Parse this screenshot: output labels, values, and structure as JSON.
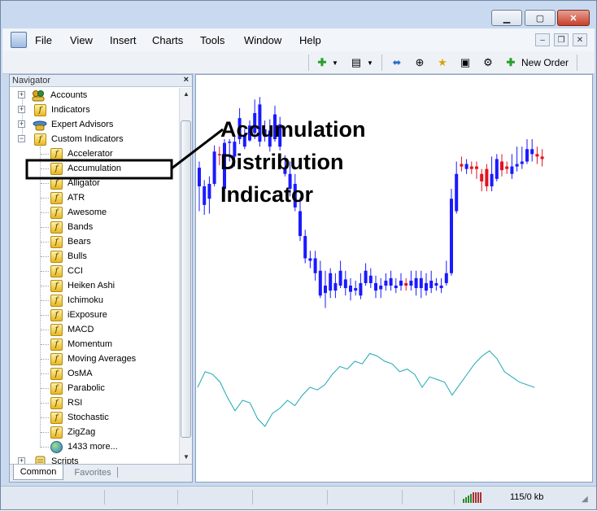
{
  "window": {
    "buttons": {
      "minimize": "▁",
      "maximize": "▢",
      "close": "✕"
    }
  },
  "menu": {
    "items": [
      "File",
      "View",
      "Insert",
      "Charts",
      "Tools",
      "Window",
      "Help"
    ],
    "mdi": {
      "minimize": "–",
      "restore": "❐",
      "close": "✕"
    }
  },
  "toolbar": {
    "new_order_label": "New Order"
  },
  "navigator": {
    "title": "Navigator",
    "close": "×",
    "top_items": [
      {
        "label": "Accounts",
        "icon": "accounts-icon",
        "expander": "+"
      },
      {
        "label": "Indicators",
        "icon": "indicators-icon",
        "expander": "+"
      },
      {
        "label": "Expert Advisors",
        "icon": "expert-advisors-icon",
        "expander": "+"
      },
      {
        "label": "Custom Indicators",
        "icon": "custom-indicators-icon",
        "expander": "−"
      }
    ],
    "custom_indicators": [
      "Accelerator",
      "Accumulation",
      "Alligator",
      "ATR",
      "Awesome",
      "Bands",
      "Bears",
      "Bulls",
      "CCI",
      "Heiken Ashi",
      "Ichimoku",
      "iExposure",
      "MACD",
      "Momentum",
      "Moving Averages",
      "OsMA",
      "Parabolic",
      "RSI",
      "Stochastic",
      "ZigZag"
    ],
    "more_label": "1433 more...",
    "scripts_label": "Scripts",
    "scripts_expander": "+",
    "tabs": [
      "Common",
      "Favorites"
    ]
  },
  "annotation": {
    "lines": [
      "Accumulation",
      "Distribution",
      "Indicator"
    ]
  },
  "status": {
    "traffic": "115/0 kb"
  },
  "colors": {
    "bull": "#1a1aff",
    "bear": "#e0141e",
    "indicator_line": "#1ea8b4"
  },
  "chart_data": {
    "type": "candlestick",
    "candles": [
      {
        "o": 320,
        "c": 335,
        "h": 340,
        "l": 300
      },
      {
        "o": 305,
        "c": 320,
        "h": 325,
        "l": 297
      },
      {
        "o": 310,
        "c": 322,
        "h": 328,
        "l": 298
      },
      {
        "o": 322,
        "c": 348,
        "h": 353,
        "l": 320
      },
      {
        "o": 346,
        "c": 345,
        "h": 352,
        "l": 337
      },
      {
        "o": 318,
        "c": 355,
        "h": 358,
        "l": 314
      },
      {
        "o": 356,
        "c": 356,
        "h": 358,
        "l": 340
      },
      {
        "o": 344,
        "c": 356,
        "h": 360,
        "l": 336
      },
      {
        "o": 358,
        "c": 375,
        "h": 383,
        "l": 354
      },
      {
        "o": 352,
        "c": 361,
        "h": 366,
        "l": 350
      },
      {
        "o": 357,
        "c": 369,
        "h": 373,
        "l": 356
      },
      {
        "o": 363,
        "c": 379,
        "h": 390,
        "l": 358
      },
      {
        "o": 356,
        "c": 386,
        "h": 392,
        "l": 352
      },
      {
        "o": 360,
        "c": 366,
        "h": 373,
        "l": 356
      },
      {
        "o": 352,
        "c": 365,
        "h": 374,
        "l": 348
      },
      {
        "o": 358,
        "c": 378,
        "h": 385,
        "l": 356
      },
      {
        "o": 352,
        "c": 370,
        "h": 376,
        "l": 349
      },
      {
        "o": 330,
        "c": 335,
        "h": 345,
        "l": 328
      },
      {
        "o": 318,
        "c": 330,
        "h": 340,
        "l": 312
      },
      {
        "o": 303,
        "c": 322,
        "h": 330,
        "l": 300
      },
      {
        "o": 280,
        "c": 300,
        "h": 311,
        "l": 276
      },
      {
        "o": 262,
        "c": 280,
        "h": 285,
        "l": 258
      },
      {
        "o": 260,
        "c": 262,
        "h": 268,
        "l": 254
      },
      {
        "o": 250,
        "c": 262,
        "h": 268,
        "l": 244
      },
      {
        "o": 232,
        "c": 252,
        "h": 260,
        "l": 230
      },
      {
        "o": 234,
        "c": 240,
        "h": 252,
        "l": 222
      },
      {
        "o": 236,
        "c": 250,
        "h": 254,
        "l": 230
      },
      {
        "o": 236,
        "c": 242,
        "h": 250,
        "l": 230
      },
      {
        "o": 240,
        "c": 252,
        "h": 260,
        "l": 238
      },
      {
        "o": 238,
        "c": 245,
        "h": 252,
        "l": 232
      },
      {
        "o": 235,
        "c": 240,
        "h": 246,
        "l": 228
      },
      {
        "o": 236,
        "c": 238,
        "h": 244,
        "l": 232
      },
      {
        "o": 232,
        "c": 242,
        "h": 250,
        "l": 229
      },
      {
        "o": 242,
        "c": 252,
        "h": 258,
        "l": 240
      },
      {
        "o": 242,
        "c": 248,
        "h": 254,
        "l": 238
      },
      {
        "o": 236,
        "c": 242,
        "h": 248,
        "l": 230
      },
      {
        "o": 237,
        "c": 240,
        "h": 246,
        "l": 230
      },
      {
        "o": 240,
        "c": 244,
        "h": 250,
        "l": 236
      },
      {
        "o": 240,
        "c": 246,
        "h": 252,
        "l": 236
      },
      {
        "o": 238,
        "c": 240,
        "h": 246,
        "l": 234
      },
      {
        "o": 240,
        "c": 244,
        "h": 250,
        "l": 236
      },
      {
        "o": 242,
        "c": 240,
        "h": 246,
        "l": 236
      },
      {
        "o": 240,
        "c": 244,
        "h": 252,
        "l": 236
      },
      {
        "o": 238,
        "c": 246,
        "h": 252,
        "l": 232
      },
      {
        "o": 238,
        "c": 246,
        "h": 252,
        "l": 230
      },
      {
        "o": 236,
        "c": 242,
        "h": 250,
        "l": 232
      },
      {
        "o": 238,
        "c": 244,
        "h": 252,
        "l": 234
      },
      {
        "o": 240,
        "c": 242,
        "h": 246,
        "l": 236
      },
      {
        "o": 238,
        "c": 240,
        "h": 246,
        "l": 234
      },
      {
        "o": 242,
        "c": 250,
        "h": 260,
        "l": 240
      },
      {
        "o": 250,
        "c": 310,
        "h": 318,
        "l": 248
      },
      {
        "o": 300,
        "c": 330,
        "h": 340,
        "l": 298
      },
      {
        "o": 338,
        "c": 336,
        "h": 344,
        "l": 332
      },
      {
        "o": 334,
        "c": 338,
        "h": 342,
        "l": 330
      },
      {
        "o": 336,
        "c": 334,
        "h": 340,
        "l": 330
      },
      {
        "o": 336,
        "c": 334,
        "h": 340,
        "l": 326
      },
      {
        "o": 330,
        "c": 324,
        "h": 334,
        "l": 316
      },
      {
        "o": 334,
        "c": 320,
        "h": 338,
        "l": 316
      },
      {
        "o": 320,
        "c": 330,
        "h": 344,
        "l": 316
      },
      {
        "o": 326,
        "c": 342,
        "h": 346,
        "l": 324
      },
      {
        "o": 340,
        "c": 333,
        "h": 346,
        "l": 328
      },
      {
        "o": 336,
        "c": 334,
        "h": 340,
        "l": 330
      },
      {
        "o": 330,
        "c": 336,
        "h": 346,
        "l": 326
      },
      {
        "o": 336,
        "c": 338,
        "h": 352,
        "l": 332
      },
      {
        "o": 338,
        "c": 340,
        "h": 352,
        "l": 334
      },
      {
        "o": 340,
        "c": 350,
        "h": 358,
        "l": 338
      },
      {
        "o": 346,
        "c": 350,
        "h": 358,
        "l": 340
      },
      {
        "o": 346,
        "c": 344,
        "h": 352,
        "l": 338
      },
      {
        "o": 344,
        "c": 342,
        "h": 350,
        "l": 336
      }
    ],
    "indicator": [
      60,
      72,
      70,
      64,
      52,
      42,
      50,
      48,
      36,
      30,
      40,
      44,
      50,
      46,
      54,
      60,
      58,
      62,
      70,
      76,
      74,
      80,
      78,
      86,
      84,
      80,
      78,
      72,
      74,
      70,
      60,
      68,
      66,
      64,
      54,
      62,
      70,
      78,
      84,
      88,
      82,
      72,
      68,
      64,
      62,
      60
    ]
  }
}
